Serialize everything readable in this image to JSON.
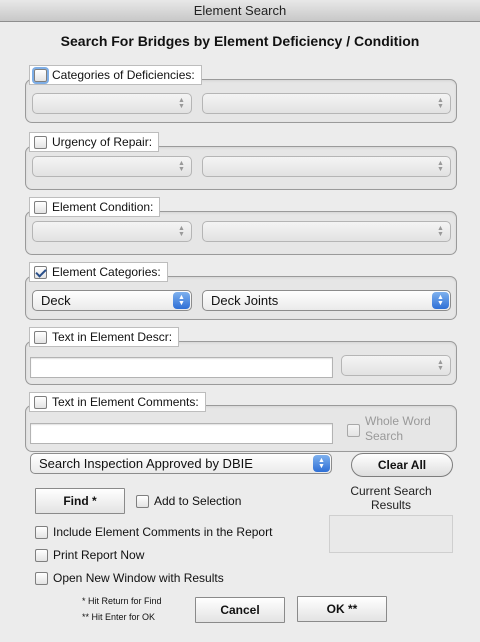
{
  "window": {
    "title": "Element Search"
  },
  "heading": "Search For Bridges by Element Deficiency / Condition",
  "groups": {
    "deficiencies": {
      "label": "Categories of Deficiencies:",
      "checked": false,
      "select1": "",
      "select2": ""
    },
    "urgency": {
      "label": "Urgency of Repair:",
      "checked": false,
      "select1": "",
      "select2": ""
    },
    "condition": {
      "label": "Element Condition:",
      "checked": false,
      "select1": "",
      "select2": ""
    },
    "categories": {
      "label": "Element Categories:",
      "checked": true,
      "select1": "Deck",
      "select2": "Deck Joints"
    },
    "descr": {
      "label": "Text in Element Descr:",
      "checked": false,
      "text_value": "",
      "select1": ""
    },
    "comments": {
      "label": "Text in Element Comments:",
      "checked": false,
      "text_value": "",
      "whole_word_label_1": "Whole Word",
      "whole_word_label_2": "Search"
    }
  },
  "search_type": {
    "selected": "Search Inspection Approved by DBIE"
  },
  "buttons": {
    "clear_all": "Clear All",
    "find": "Find *",
    "cancel": "Cancel",
    "ok": "OK **"
  },
  "options": {
    "add_to_selection": "Add to Selection",
    "include_comments": "Include Element Comments in the Report",
    "print_report": "Print Report Now",
    "open_new_window": "Open New Window with Results"
  },
  "results": {
    "label_1": "Current Search",
    "label_2": "Results",
    "value": ""
  },
  "notes": {
    "return_hint": "* Hit Return for Find",
    "enter_hint": "** Hit Enter for OK"
  }
}
